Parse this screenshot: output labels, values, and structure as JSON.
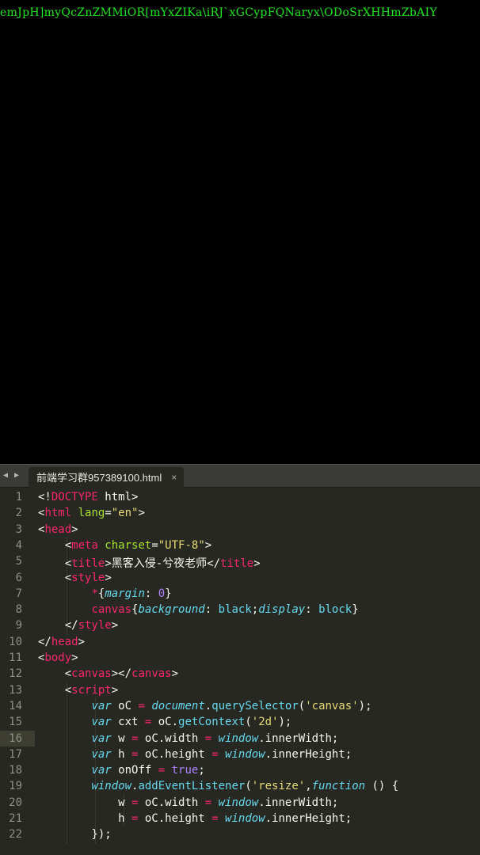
{
  "matrix": {
    "text": "emJpH]myQcZnZMMiOR[mYxZIKa\\iRJ`xGCypFQNaryx\\ODoSrXHHmZbAIY",
    "color": "#1ee81e"
  },
  "editor": {
    "tab_title": "前端学习群957389100.html",
    "tab_close_icon": "×",
    "nav_left_icon": "◀",
    "nav_right_icon": "▶",
    "active_line": 16,
    "lines": [
      [
        [
          "pun",
          "<!"
        ],
        [
          "tag",
          "DOCTYPE"
        ],
        [
          "plain",
          " html"
        ],
        [
          "pun",
          ">"
        ]
      ],
      [
        [
          "pun",
          "<"
        ],
        [
          "tag",
          "html"
        ],
        [
          "att",
          " lang"
        ],
        [
          "pun",
          "="
        ],
        [
          "str",
          "\"en\""
        ],
        [
          "pun",
          ">"
        ]
      ],
      [
        [
          "pun",
          "<"
        ],
        [
          "tag",
          "head"
        ],
        [
          "pun",
          ">"
        ]
      ],
      [
        [
          "plain",
          "    "
        ],
        [
          "pun",
          "<"
        ],
        [
          "tag",
          "meta"
        ],
        [
          "att",
          " charset"
        ],
        [
          "pun",
          "="
        ],
        [
          "str",
          "\"UTF-8\""
        ],
        [
          "pun",
          ">"
        ]
      ],
      [
        [
          "plain",
          "    "
        ],
        [
          "pun",
          "<"
        ],
        [
          "tag",
          "title"
        ],
        [
          "pun",
          ">"
        ],
        [
          "plain",
          "黑客入侵-兮夜老师"
        ],
        [
          "pun",
          "</"
        ],
        [
          "tag",
          "title"
        ],
        [
          "pun",
          ">"
        ]
      ],
      [
        [
          "plain",
          "    "
        ],
        [
          "pun",
          "<"
        ],
        [
          "tag",
          "style"
        ],
        [
          "pun",
          ">"
        ]
      ],
      [
        [
          "plain",
          "        "
        ],
        [
          "opr",
          "*"
        ],
        [
          "pun",
          "{"
        ],
        [
          "prop",
          "margin"
        ],
        [
          "pun",
          ": "
        ],
        [
          "num",
          "0"
        ],
        [
          "pun",
          "}"
        ]
      ],
      [
        [
          "plain",
          "        "
        ],
        [
          "tag",
          "canvas"
        ],
        [
          "pun",
          "{"
        ],
        [
          "prop",
          "background"
        ],
        [
          "pun",
          ": "
        ],
        [
          "fn",
          "black"
        ],
        [
          "pun",
          ";"
        ],
        [
          "prop",
          "display"
        ],
        [
          "pun",
          ": "
        ],
        [
          "fn",
          "block"
        ],
        [
          "pun",
          "}"
        ]
      ],
      [
        [
          "plain",
          "    "
        ],
        [
          "pun",
          "</"
        ],
        [
          "tag",
          "style"
        ],
        [
          "pun",
          ">"
        ]
      ],
      [
        [
          "pun",
          "</"
        ],
        [
          "tag",
          "head"
        ],
        [
          "pun",
          ">"
        ]
      ],
      [
        [
          "pun",
          "<"
        ],
        [
          "tag",
          "body"
        ],
        [
          "pun",
          ">"
        ]
      ],
      [
        [
          "plain",
          "    "
        ],
        [
          "pun",
          "<"
        ],
        [
          "tag",
          "canvas"
        ],
        [
          "pun",
          "></"
        ],
        [
          "tag",
          "canvas"
        ],
        [
          "pun",
          ">"
        ]
      ],
      [
        [
          "plain",
          "    "
        ],
        [
          "pun",
          "<"
        ],
        [
          "tag",
          "script"
        ],
        [
          "pun",
          ">"
        ]
      ],
      [
        [
          "plain",
          "        "
        ],
        [
          "kw",
          "var"
        ],
        [
          "plain",
          " oC "
        ],
        [
          "opr",
          "="
        ],
        [
          "plain",
          " "
        ],
        [
          "kw",
          "document"
        ],
        [
          "pun",
          "."
        ],
        [
          "fn",
          "querySelector"
        ],
        [
          "pun",
          "("
        ],
        [
          "str",
          "'canvas'"
        ],
        [
          "pun",
          ");"
        ]
      ],
      [
        [
          "plain",
          "        "
        ],
        [
          "kw",
          "var"
        ],
        [
          "plain",
          " cxt "
        ],
        [
          "opr",
          "="
        ],
        [
          "plain",
          " oC."
        ],
        [
          "fn",
          "getContext"
        ],
        [
          "pun",
          "("
        ],
        [
          "str",
          "'2d'"
        ],
        [
          "pun",
          ");"
        ]
      ],
      [
        [
          "plain",
          "        "
        ],
        [
          "kw",
          "var"
        ],
        [
          "plain",
          " w "
        ],
        [
          "opr",
          "="
        ],
        [
          "plain",
          " oC.width "
        ],
        [
          "opr",
          "="
        ],
        [
          "plain",
          " "
        ],
        [
          "kw",
          "window"
        ],
        [
          "plain",
          ".innerWidth;"
        ]
      ],
      [
        [
          "plain",
          "        "
        ],
        [
          "kw",
          "var"
        ],
        [
          "plain",
          " h "
        ],
        [
          "opr",
          "="
        ],
        [
          "plain",
          " oC.height "
        ],
        [
          "opr",
          "="
        ],
        [
          "plain",
          " "
        ],
        [
          "kw",
          "window"
        ],
        [
          "plain",
          ".innerHeight;"
        ]
      ],
      [
        [
          "plain",
          "        "
        ],
        [
          "kw",
          "var"
        ],
        [
          "plain",
          " onOff "
        ],
        [
          "opr",
          "="
        ],
        [
          "plain",
          " "
        ],
        [
          "bool",
          "true"
        ],
        [
          "pun",
          ";"
        ]
      ],
      [
        [
          "plain",
          "        "
        ],
        [
          "kw",
          "window"
        ],
        [
          "pun",
          "."
        ],
        [
          "fn",
          "addEventListener"
        ],
        [
          "pun",
          "("
        ],
        [
          "str",
          "'resize'"
        ],
        [
          "pun",
          ","
        ],
        [
          "kw",
          "function"
        ],
        [
          "plain",
          " () {"
        ]
      ],
      [
        [
          "plain",
          "            w "
        ],
        [
          "opr",
          "="
        ],
        [
          "plain",
          " oC.width "
        ],
        [
          "opr",
          "="
        ],
        [
          "plain",
          " "
        ],
        [
          "kw",
          "window"
        ],
        [
          "plain",
          ".innerWidth;"
        ]
      ],
      [
        [
          "plain",
          "            h "
        ],
        [
          "opr",
          "="
        ],
        [
          "plain",
          " oC.height "
        ],
        [
          "opr",
          "="
        ],
        [
          "plain",
          " "
        ],
        [
          "kw",
          "window"
        ],
        [
          "plain",
          ".innerHeight;"
        ]
      ],
      [
        [
          "plain",
          "        });"
        ]
      ]
    ]
  }
}
